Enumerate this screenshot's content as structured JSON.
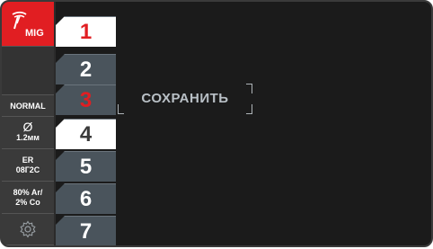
{
  "sidebar": {
    "process_label": "MIG",
    "mode_label": "NORMAL",
    "diameter_symbol": "Ø",
    "diameter_value": "1.2мм",
    "wire_line1": "ER",
    "wire_line2": "08Г2С",
    "gas_line1": "80% Ar/",
    "gas_line2": "2% Co",
    "icons": [
      "mig-torch-icon",
      "gear-icon"
    ]
  },
  "programs": {
    "tabs": [
      "1",
      "2",
      "3",
      "4",
      "5",
      "6",
      "7"
    ],
    "selected": "1"
  },
  "action": {
    "save_label": "СОХРАНИТЬ"
  },
  "colors": {
    "accent": "#e11e22",
    "tab": "#4a545c",
    "background": "#1b1b1b"
  }
}
